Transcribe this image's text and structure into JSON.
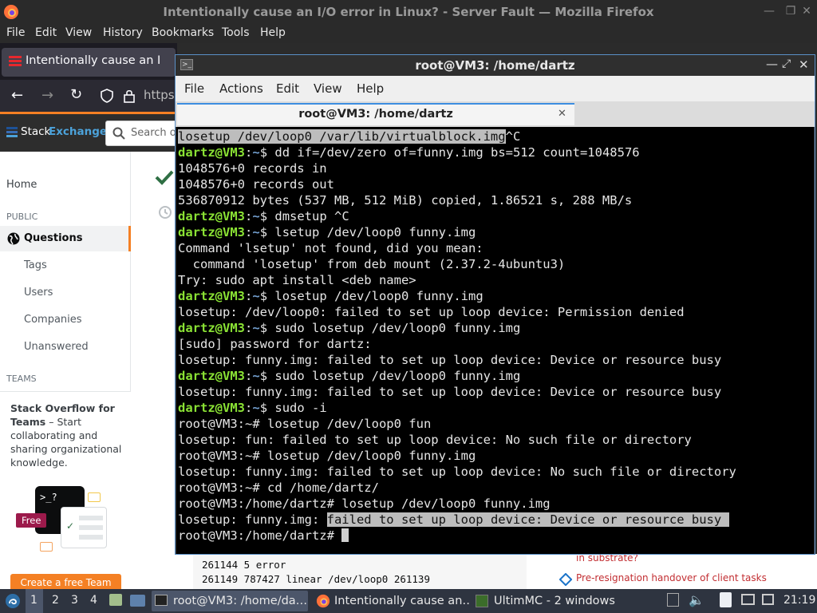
{
  "firefox": {
    "window_title": "Intentionally cause an I/O error in Linux? - Server Fault — Mozilla Firefox",
    "menu": [
      "File",
      "Edit",
      "View",
      "History",
      "Bookmarks",
      "Tools",
      "Help"
    ],
    "tab_title": "Intentionally cause an I/O error in Linux? - Server Fault",
    "url_partial": "https"
  },
  "stackexchange": {
    "brand_prefix": "Stack",
    "brand_suffix": "Exchange",
    "search_placeholder": "Search o",
    "nav": {
      "home": "Home",
      "public_label": "PUBLIC",
      "questions": "Questions",
      "tags": "Tags",
      "users": "Users",
      "companies": "Companies",
      "unanswered": "Unanswered",
      "teams_label": "TEAMS"
    },
    "teams_promo": {
      "title": "Stack Overflow for Teams",
      "text": " – Start collaborating and sharing organizational knowledge.",
      "badge": "Free",
      "button": "Create a free Team"
    },
    "behind_terminal": {
      "code_line_1": "261144 5 error",
      "code_line_2": "261149 787427 linear /dev/loop0 261139",
      "link_1": "in substrate?",
      "link_2": "Pre-resignation handover of client tasks"
    }
  },
  "terminal": {
    "window_title": "root@VM3: /home/dartz",
    "menu": [
      "File",
      "Actions",
      "Edit",
      "View",
      "Help"
    ],
    "tab_title": "root@VM3: /home/dartz",
    "lines": [
      {
        "kind": "plain",
        "text": "losetup /dev/loop0 /var/lib/virtualblock.img",
        "suffix": "^C",
        "highlight": "text"
      },
      {
        "kind": "user",
        "cmd": "dd if=/dev/zero of=funny.img bs=512 count=1048576"
      },
      {
        "kind": "plain",
        "text": "1048576+0 records in"
      },
      {
        "kind": "plain",
        "text": "1048576+0 records out"
      },
      {
        "kind": "plain",
        "text": "536870912 bytes (537 MB, 512 MiB) copied, 1.86521 s, 288 MB/s"
      },
      {
        "kind": "user",
        "cmd": "dmsetup ^C"
      },
      {
        "kind": "user",
        "cmd": "lsetup /dev/loop0 funny.img"
      },
      {
        "kind": "plain",
        "text": "Command 'lsetup' not found, did you mean:"
      },
      {
        "kind": "plain",
        "text": "  command 'losetup' from deb mount (2.37.2-4ubuntu3)"
      },
      {
        "kind": "plain",
        "text": "Try: sudo apt install <deb name>"
      },
      {
        "kind": "user",
        "cmd": "losetup /dev/loop0 funny.img"
      },
      {
        "kind": "plain",
        "text": "losetup: /dev/loop0: failed to set up loop device: Permission denied"
      },
      {
        "kind": "user",
        "cmd": "sudo losetup /dev/loop0 funny.img"
      },
      {
        "kind": "plain",
        "text": "[sudo] password for dartz:"
      },
      {
        "kind": "plain",
        "text": "losetup: funny.img: failed to set up loop device: Device or resource busy"
      },
      {
        "kind": "user",
        "cmd": "sudo losetup /dev/loop0 funny.img"
      },
      {
        "kind": "plain",
        "text": "losetup: funny.img: failed to set up loop device: Device or resource busy"
      },
      {
        "kind": "user",
        "cmd": "sudo -i"
      },
      {
        "kind": "plain",
        "text": "root@VM3:~# losetup /dev/loop0 fun"
      },
      {
        "kind": "plain",
        "text": "losetup: fun: failed to set up loop device: No such file or directory"
      },
      {
        "kind": "plain",
        "text": "root@VM3:~# losetup /dev/loop0 funny.img"
      },
      {
        "kind": "plain",
        "text": "losetup: funny.img: failed to set up loop device: No such file or directory"
      },
      {
        "kind": "plain",
        "text": "root@VM3:~# cd /home/dartz/"
      },
      {
        "kind": "plain",
        "text": "root@VM3:/home/dartz# losetup /dev/loop0 funny.img"
      },
      {
        "kind": "split",
        "text": "losetup: funny.img: ",
        "hl": "failed to set up loop device: Device or resource busy "
      },
      {
        "kind": "cursor",
        "text": "root@VM3:/home/dartz# "
      }
    ],
    "prompt_user": "dartz@VM3",
    "prompt_sep": ":",
    "prompt_path": "~",
    "prompt_end": "$ "
  },
  "taskbar": {
    "workspaces": [
      "1",
      "2",
      "3",
      "4"
    ],
    "tasks": [
      "root@VM3: /home/da…",
      "Intentionally cause an…",
      "UltimMC - 2 windows"
    ],
    "clock": "21:19"
  }
}
